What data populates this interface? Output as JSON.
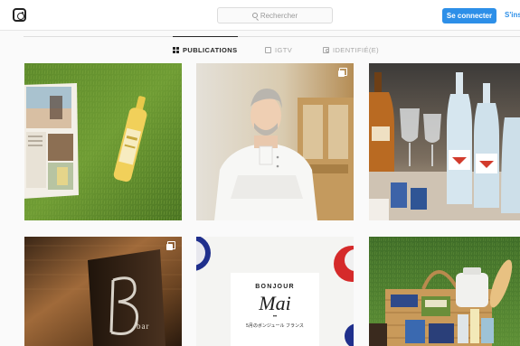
{
  "header": {
    "search_placeholder": "Rechercher",
    "login_label": "Se connecter",
    "signup_label": "S'inscrire"
  },
  "tabs": [
    {
      "label": "PUBLICATIONS",
      "active": true
    },
    {
      "label": "IGTV",
      "active": false
    },
    {
      "label": "IDENTIFIÉ(E)",
      "active": false
    }
  ],
  "posts": {
    "p5": {
      "sign_text": "bar"
    },
    "p6": {
      "line1": "BONJOUR",
      "line2": "Mai",
      "dots": "••",
      "line3": "5月のボンジュール フランス"
    }
  },
  "colors": {
    "accent": "#2d8fe8"
  }
}
